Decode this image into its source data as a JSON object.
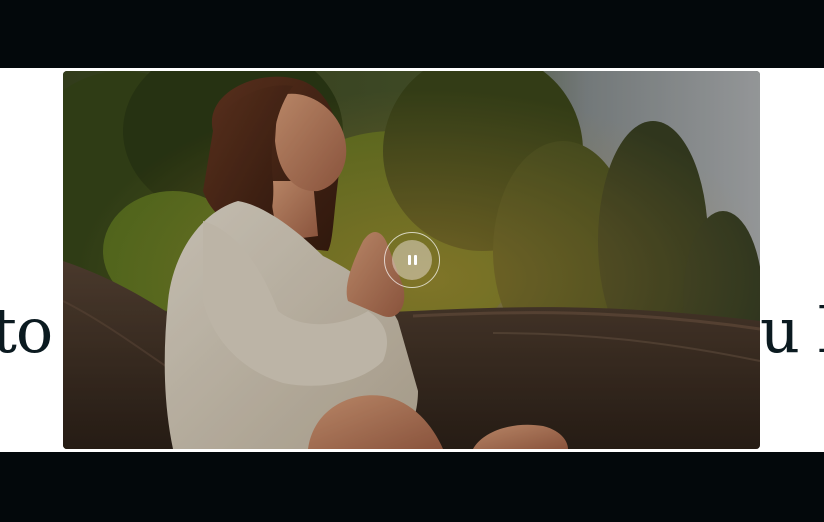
{
  "slider": {
    "left_word": "to",
    "right_word": "u l"
  },
  "video": {
    "state": "playing",
    "control_icon": "pause-icon",
    "control_label": "Pause video"
  },
  "colors": {
    "letterbox": "#03080b",
    "page_background": "#ffffff",
    "headline_text": "#0b1a20"
  }
}
